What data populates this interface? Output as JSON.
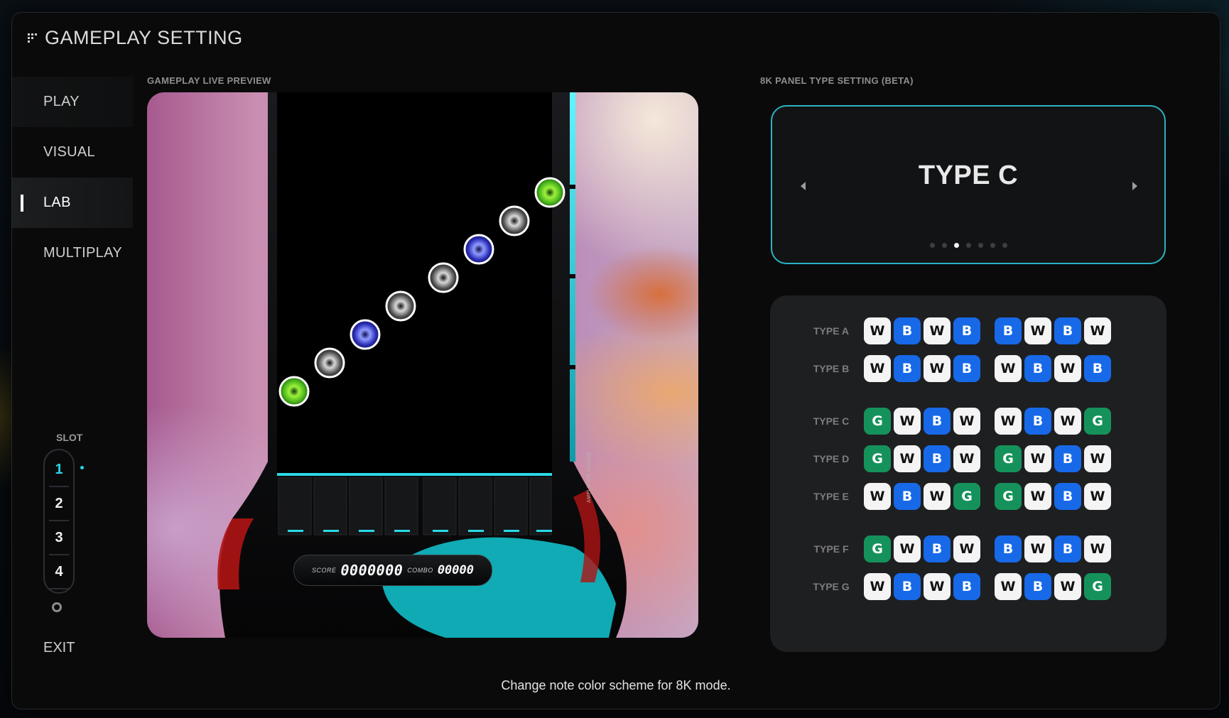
{
  "header": {
    "title": "GAMEPLAY SETTING"
  },
  "sidebar": {
    "items": [
      {
        "label": "PLAY"
      },
      {
        "label": "VISUAL"
      },
      {
        "label": "LAB"
      },
      {
        "label": "MULTIPLAY"
      }
    ],
    "active_index": 2,
    "exit_label": "EXIT"
  },
  "slot": {
    "label": "SLOT",
    "options": [
      "1",
      "2",
      "3",
      "4"
    ],
    "selected": "1"
  },
  "preview": {
    "label": "GAMEPLAY LIVE PREVIEW",
    "score_caption": "SCORE",
    "score_value": "0000000",
    "combo_caption": "COMBO",
    "combo_value": "00000",
    "gauge_label": "AMPLIFIER GAUGE",
    "notes": [
      {
        "lane": 1,
        "color": "green"
      },
      {
        "lane": 2,
        "color": "white"
      },
      {
        "lane": 3,
        "color": "blue"
      },
      {
        "lane": 4,
        "color": "white"
      },
      {
        "lane": 5,
        "color": "white"
      },
      {
        "lane": 6,
        "color": "blue"
      },
      {
        "lane": 7,
        "color": "white"
      },
      {
        "lane": 8,
        "color": "green"
      }
    ]
  },
  "panel_type": {
    "label": "8K PANEL TYPE SETTING (BETA)",
    "selected": "TYPE C",
    "page_count": 7,
    "page_index": 2
  },
  "types": [
    {
      "label": "TYPE A",
      "left": [
        "W",
        "B",
        "W",
        "B"
      ],
      "right": [
        "B",
        "W",
        "B",
        "W"
      ]
    },
    {
      "label": "TYPE B",
      "left": [
        "W",
        "B",
        "W",
        "B"
      ],
      "right": [
        "W",
        "B",
        "W",
        "B"
      ]
    },
    {
      "label": "TYPE C",
      "left": [
        "G",
        "W",
        "B",
        "W"
      ],
      "right": [
        "W",
        "B",
        "W",
        "G"
      ]
    },
    {
      "label": "TYPE D",
      "left": [
        "G",
        "W",
        "B",
        "W"
      ],
      "right": [
        "G",
        "W",
        "B",
        "W"
      ]
    },
    {
      "label": "TYPE E",
      "left": [
        "W",
        "B",
        "W",
        "G"
      ],
      "right": [
        "G",
        "W",
        "B",
        "W"
      ]
    },
    {
      "label": "TYPE F",
      "left": [
        "G",
        "W",
        "B",
        "W"
      ],
      "right": [
        "B",
        "W",
        "B",
        "W"
      ]
    },
    {
      "label": "TYPE G",
      "left": [
        "W",
        "B",
        "W",
        "B"
      ],
      "right": [
        "W",
        "B",
        "W",
        "G"
      ]
    }
  ],
  "hint": "Change note color scheme for 8K mode.",
  "colors": {
    "accent": "#27d6e8",
    "key_white": "#f4f4f4",
    "key_blue": "#1769e8",
    "key_green": "#15925b"
  }
}
